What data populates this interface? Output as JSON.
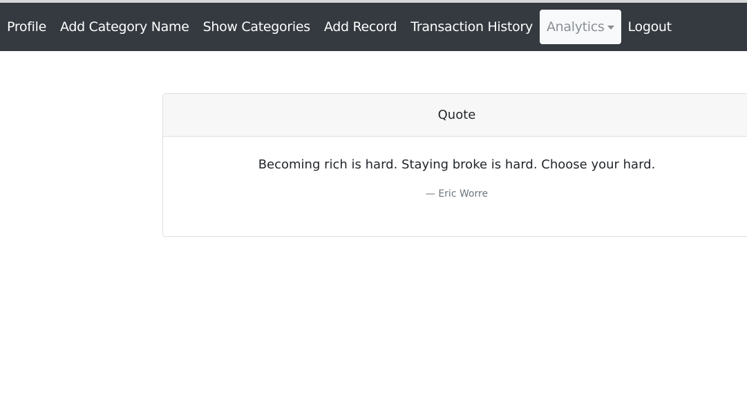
{
  "nav": {
    "items": [
      "Profile",
      "Add Category Name",
      "Show Categories",
      "Add Record",
      "Transaction History"
    ],
    "analytics": "Analytics",
    "logout": "Logout"
  },
  "card": {
    "header": "Quote",
    "quote": "Becoming rich is hard. Staying broke is hard. Choose your hard.",
    "author": "— Eric Worre"
  }
}
